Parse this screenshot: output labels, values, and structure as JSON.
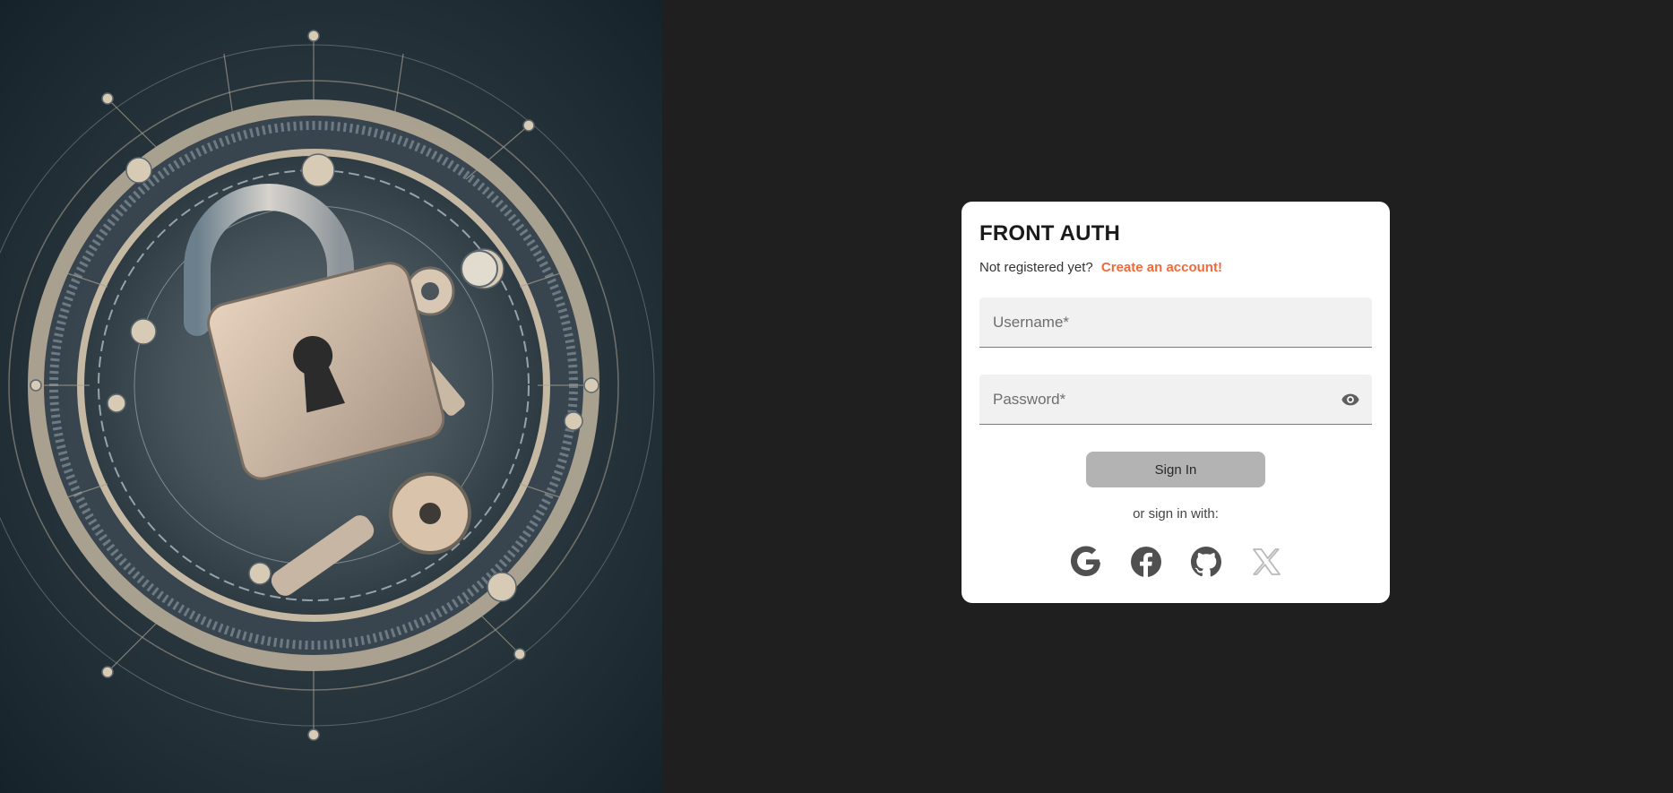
{
  "hero": {
    "image_description_icon": "padlock-key-illustration"
  },
  "card": {
    "title": "FRONT AUTH",
    "register_prompt": "Not registered yet?",
    "register_link": "Create an account!",
    "username_placeholder": "Username*",
    "password_placeholder": "Password*",
    "signin_label": "Sign In",
    "alt_signin_text": "or sign in with:",
    "social_providers": [
      "google-icon",
      "facebook-icon",
      "github-icon",
      "x-icon"
    ]
  },
  "colors": {
    "page_background": "#1f1f1f",
    "accent_link": "#f06a3a",
    "button_disabled": "#b3b3b3"
  }
}
